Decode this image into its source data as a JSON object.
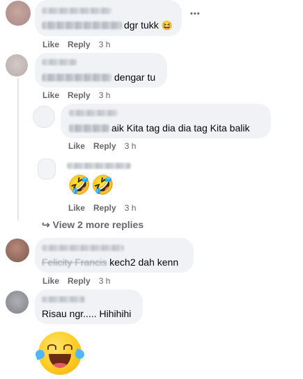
{
  "actions": {
    "like": "Like",
    "reply": "Reply"
  },
  "more_icon": "•••",
  "comments": [
    {
      "text": "dgr tukk",
      "time": "3 h",
      "emoji": "😆"
    },
    {
      "text": "dengar tu",
      "time": "3 h"
    },
    {
      "text": "aik Kita tag dia dia tag Kita balik",
      "time": "3 h"
    },
    {
      "time": "3 h",
      "emoji": "🤣🤣"
    },
    {
      "mention": "Felicity Francis",
      "text": "kech2 dah kenn",
      "time": "3 h"
    },
    {
      "text": "Risau ngr..... Hihihihi"
    }
  ],
  "view_more": {
    "arrow": "↪",
    "label": "View 2 more replies"
  },
  "big_emoji": "😂",
  "colors": {
    "bubble": "#f0f2f5",
    "action_text": "#65676b",
    "text": "#050505"
  }
}
